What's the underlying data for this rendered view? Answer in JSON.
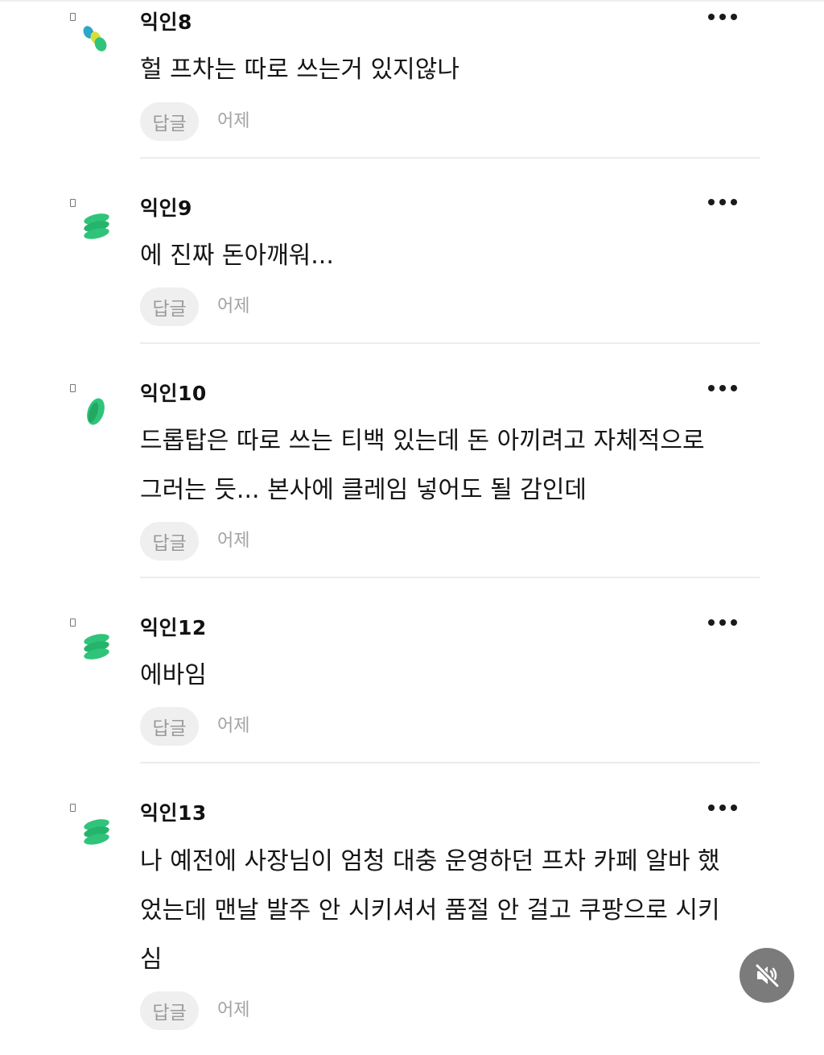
{
  "comments": [
    {
      "author": "익인8",
      "lines": [
        "헐 프차는 따로 쓰는거 있지않나"
      ],
      "reply_label": "답글",
      "time": "어제",
      "avatar": "teal-yellow-green-blob-icon"
    },
    {
      "author": "익인9",
      "lines": [
        "에 진짜 돈아깨워..."
      ],
      "reply_label": "답글",
      "time": "어제",
      "avatar": "green-stack-icon"
    },
    {
      "author": "익인10",
      "lines": [
        "드롭탑은 따로 쓰는 티백 있는데 돈 아끼려고 자체적으로",
        "그러는 듯... 본사에 클레임 넣어도 될 감인데"
      ],
      "reply_label": "답글",
      "time": "어제",
      "avatar": "green-leaf-icon"
    },
    {
      "author": "익인12",
      "lines": [
        "에바임"
      ],
      "reply_label": "답글",
      "time": "어제",
      "avatar": "green-stack-icon"
    },
    {
      "author": "익인13",
      "lines": [
        "나 예전에 사장님이 엄청 대충 운영하던 프차 카페 알바 했",
        "었는데 맨날 발주 안 시키셔서 품절 안 걸고 쿠팡으로 시키",
        "심"
      ],
      "reply_label": "답글",
      "time": "어제",
      "avatar": "green-stack-icon"
    }
  ],
  "colors": {
    "accent_green": "#2fc47a",
    "teal": "#2aa7c9",
    "yellow": "#d6df3a"
  },
  "icons": {
    "more": "more-dots-icon",
    "mute": "speaker-muted-icon"
  }
}
